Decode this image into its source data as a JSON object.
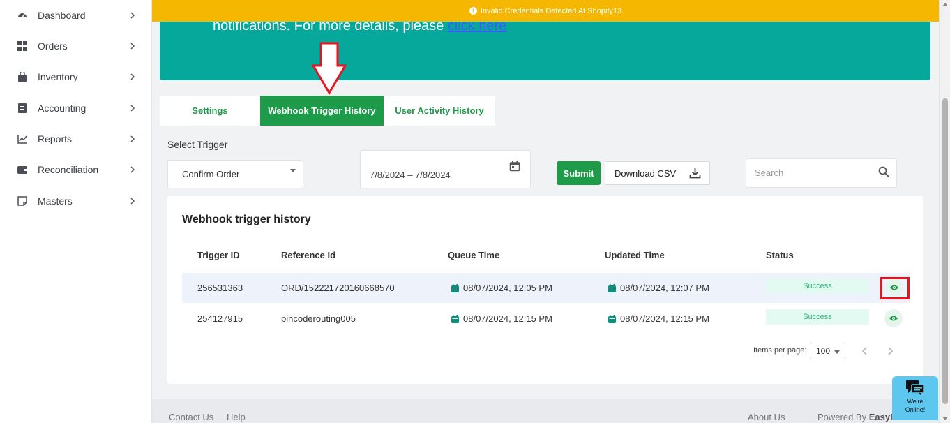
{
  "sidebar": {
    "items": [
      {
        "label": "Dashboard",
        "icon": "gauge-icon"
      },
      {
        "label": "Orders",
        "icon": "grid-icon"
      },
      {
        "label": "Inventory",
        "icon": "bag-icon"
      },
      {
        "label": "Accounting",
        "icon": "ledger-icon"
      },
      {
        "label": "Reports",
        "icon": "chart-icon"
      },
      {
        "label": "Reconciliation",
        "icon": "wallet-icon"
      },
      {
        "label": "Masters",
        "icon": "note-icon"
      }
    ]
  },
  "alert": {
    "text": "Invalid Credentials Detected At Shopify13"
  },
  "banner": {
    "text": "notifications. For more details, please ",
    "link": "click here"
  },
  "tabs": [
    {
      "label": "Settings"
    },
    {
      "label": "Webhook Trigger History"
    },
    {
      "label": "User Activity History"
    }
  ],
  "filters": {
    "trigger_label": "Select Trigger",
    "trigger_value": "Confirm Order",
    "date_range": "7/8/2024 – 7/8/2024",
    "submit_label": "Submit",
    "csv_label": "Download CSV",
    "search_placeholder": "Search"
  },
  "table": {
    "title": "Webhook trigger history",
    "columns": [
      "Trigger ID",
      "Reference Id",
      "Queue Time",
      "Updated Time",
      "Status"
    ],
    "rows": [
      {
        "trigger_id": "256531363",
        "reference_id": "ORD/152221720160668570",
        "queue_time": "08/07/2024, 12:05 PM",
        "updated_time": "08/07/2024, 12:07 PM",
        "status": "Success"
      },
      {
        "trigger_id": "254127915",
        "reference_id": "pincoderouting005",
        "queue_time": "08/07/2024, 12:15 PM",
        "updated_time": "08/07/2024, 12:15 PM",
        "status": "Success"
      }
    ],
    "pagination": {
      "items_label": "Items per page:",
      "page_size": "100"
    }
  },
  "footer": {
    "contact": "Contact Us",
    "help": "Help",
    "about": "About Us",
    "powered_prefix": "Powered By ",
    "powered_brand": "EasyEcom"
  },
  "chat": {
    "line1": "We're",
    "line2": "Online!"
  },
  "colors": {
    "brand_green": "#1e9b48",
    "banner_teal": "#06a89c",
    "alert_yellow": "#f6b700",
    "annotation_red": "#e5141f"
  }
}
